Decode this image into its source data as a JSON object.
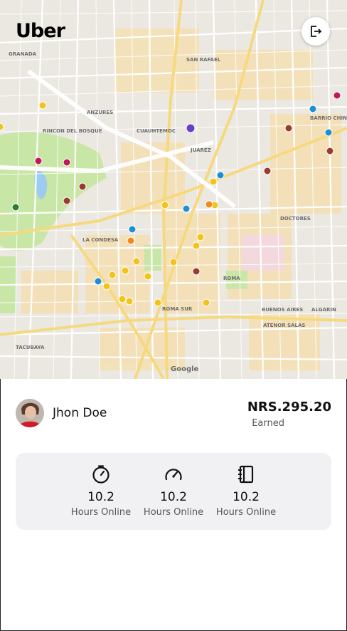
{
  "app": {
    "logo_text": "Uber"
  },
  "map": {
    "attribution": "Google",
    "labels": [
      "GRANADA",
      "ANZURES",
      "RINCON DEL BOSQUE",
      "CUAUHTEMOC",
      "SAN RAFAEL",
      "JUAREZ",
      "LA CONDESA",
      "ROMA",
      "ROMA SUR",
      "DOCTORES",
      "BUENOS AIRES",
      "ATENOR SALAS",
      "TACUBAYA",
      "ALGARIN",
      "BARRIO CHINO"
    ]
  },
  "header": {
    "logout_icon": "logout-icon"
  },
  "driver": {
    "name": "Jhon Doe",
    "earned_amount": "NRS.295.20",
    "earned_label": "Earned"
  },
  "stats": [
    {
      "icon": "timer-icon",
      "value": "10.2",
      "label": "Hours Online"
    },
    {
      "icon": "speedometer-icon",
      "value": "10.2",
      "label": "Hours Online"
    },
    {
      "icon": "notebook-icon",
      "value": "10.2",
      "label": "Hours Online"
    }
  ],
  "colors": {
    "accent": "#000000",
    "panel": "#f1f1f3",
    "park": "#c8e6a5",
    "water": "#9ecbf0",
    "road": "#ffffff",
    "arterial": "#f6d97e"
  }
}
